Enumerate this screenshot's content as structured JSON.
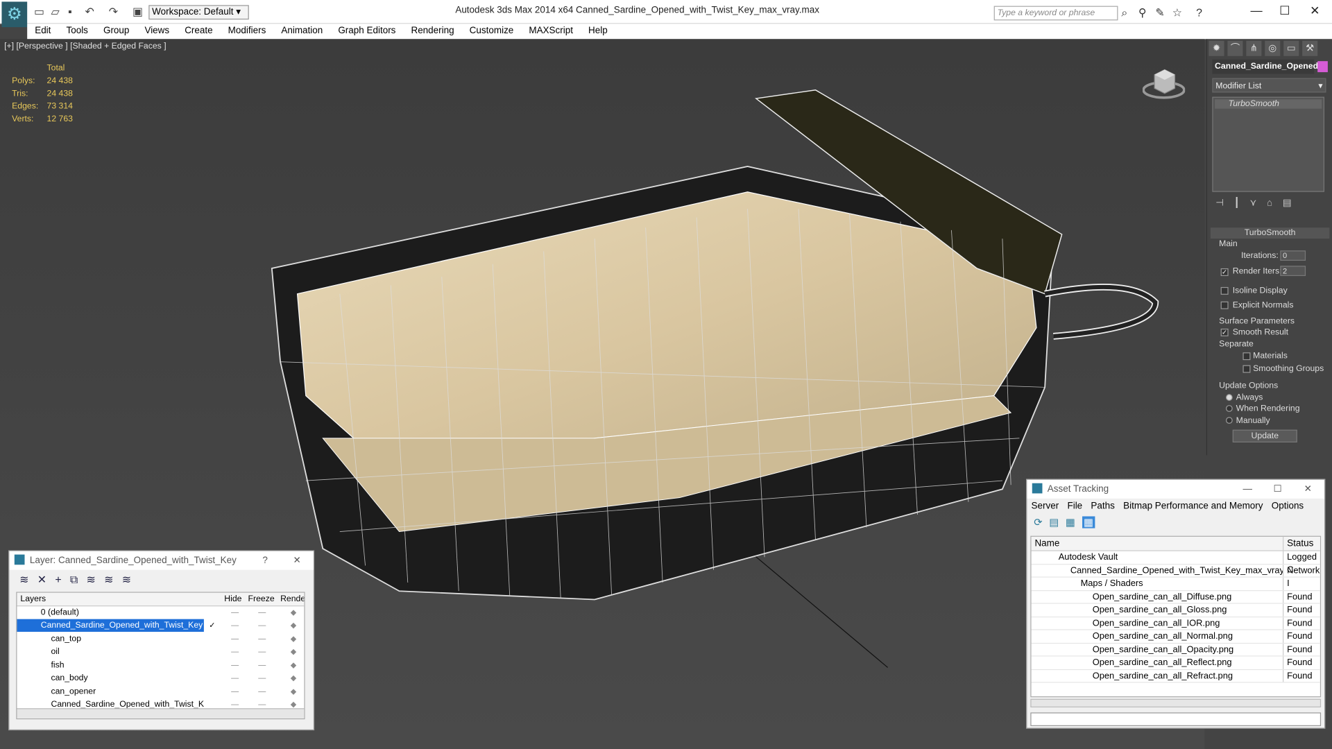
{
  "titlebar": {
    "workspace": "Workspace: Default",
    "title": "Autodesk 3ds Max  2014 x64     Canned_Sardine_Opened_with_Twist_Key_max_vray.max",
    "search_placeholder": "Type a keyword or phrase"
  },
  "menu": [
    "Edit",
    "Tools",
    "Group",
    "Views",
    "Create",
    "Modifiers",
    "Animation",
    "Graph Editors",
    "Rendering",
    "Customize",
    "MAXScript",
    "Help"
  ],
  "viewport": {
    "label": "[+] [Perspective ] [Shaded + Edged Faces ]",
    "stats": {
      "total_label": "Total",
      "rows": [
        {
          "label": "Polys:",
          "value": "24 438"
        },
        {
          "label": "Tris:",
          "value": "24 438"
        },
        {
          "label": "Edges:",
          "value": "73 314"
        },
        {
          "label": "Verts:",
          "value": "12 763"
        }
      ]
    }
  },
  "modify_panel": {
    "object_name": "Canned_Sardine_Opened",
    "object_color": "#d55cd5",
    "modifier_list": "Modifier List",
    "stack_item": "TurboSmooth",
    "rollout_title": "TurboSmooth",
    "main": "Main",
    "iterations_label": "Iterations:",
    "iterations_value": "0",
    "render_iters_label": "Render Iters:",
    "render_iters_value": "2",
    "isoline": "Isoline Display",
    "explicit_normals": "Explicit Normals",
    "surface_params": "Surface Parameters",
    "smooth_result": "Smooth Result",
    "separate": "Separate",
    "materials": "Materials",
    "smoothing_groups": "Smoothing Groups",
    "update_options": "Update Options",
    "always": "Always",
    "when_rendering": "When Rendering",
    "manually": "Manually",
    "update_button": "Update"
  },
  "asset_tracking": {
    "title": "Asset Tracking",
    "menu": [
      "Server",
      "File",
      "Paths",
      "Bitmap Performance and Memory",
      "Options"
    ],
    "col_name": "Name",
    "col_status": "Status",
    "rows": [
      {
        "name": "Autodesk Vault",
        "status": "Logged C"
      },
      {
        "name": "Canned_Sardine_Opened_with_Twist_Key_max_vray.max",
        "status": "Network I"
      },
      {
        "name": "Maps / Shaders",
        "status": ""
      },
      {
        "name": "Open_sardine_can_all_Diffuse.png",
        "status": "Found"
      },
      {
        "name": "Open_sardine_can_all_Gloss.png",
        "status": "Found"
      },
      {
        "name": "Open_sardine_can_all_IOR.png",
        "status": "Found"
      },
      {
        "name": "Open_sardine_can_all_Normal.png",
        "status": "Found"
      },
      {
        "name": "Open_sardine_can_all_Opacity.png",
        "status": "Found"
      },
      {
        "name": "Open_sardine_can_all_Reflect.png",
        "status": "Found"
      },
      {
        "name": "Open_sardine_can_all_Refract.png",
        "status": "Found"
      }
    ]
  },
  "layer_manager": {
    "title": "Layer: Canned_Sardine_Opened_with_Twist_Key",
    "help": "?",
    "col_layers": "Layers",
    "col_hide": "Hide",
    "col_freeze": "Freeze",
    "col_render": "Render",
    "rows": [
      {
        "name": "0 (default)"
      },
      {
        "name": "Canned_Sardine_Opened_with_Twist_Key"
      },
      {
        "name": "can_top"
      },
      {
        "name": "oil"
      },
      {
        "name": "fish"
      },
      {
        "name": "can_body"
      },
      {
        "name": "can_opener"
      },
      {
        "name": "Canned_Sardine_Opened_with_Twist_Key"
      }
    ]
  }
}
